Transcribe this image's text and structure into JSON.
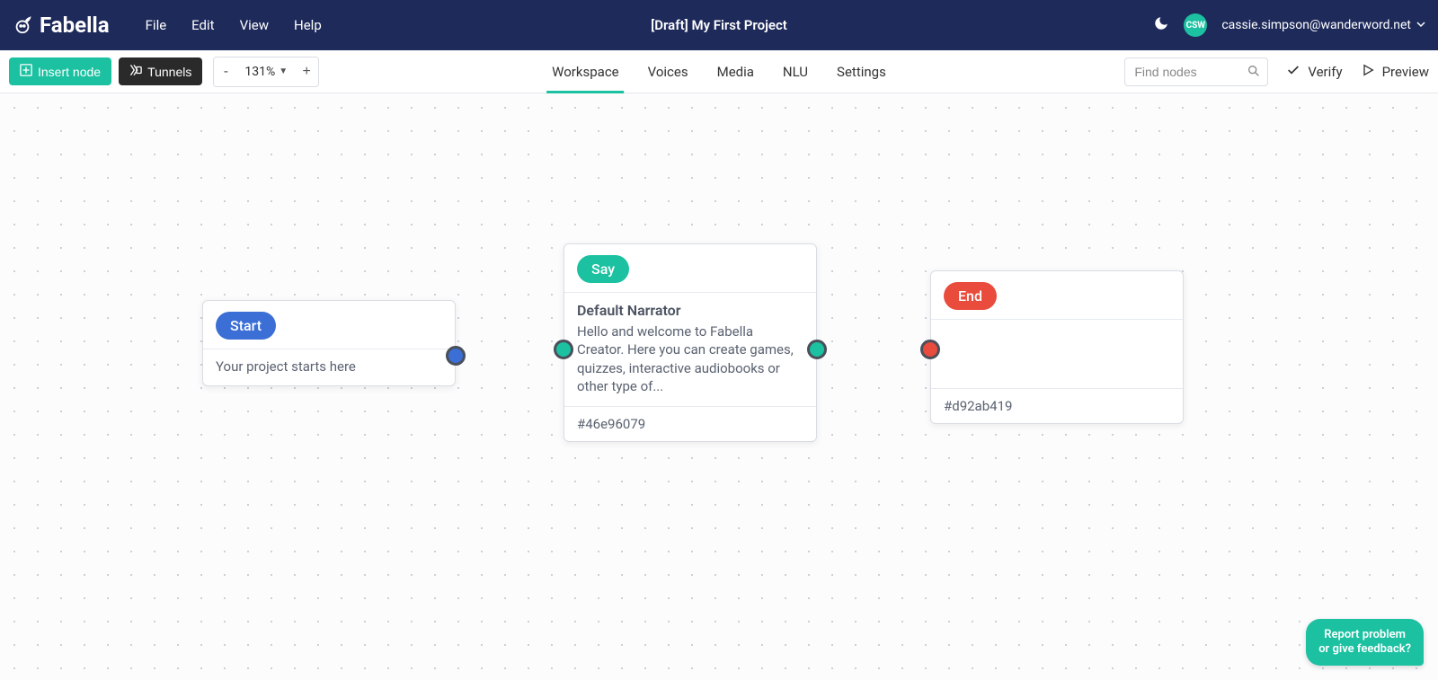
{
  "brand": {
    "name": "Fabella"
  },
  "menu": {
    "file": "File",
    "edit": "Edit",
    "view": "View",
    "help": "Help"
  },
  "project": {
    "title": "[Draft] My First Project"
  },
  "user": {
    "initials": "CSW",
    "email": "cassie.simpson@wanderword.net"
  },
  "toolbar": {
    "insert_label": "Insert node",
    "tunnels_label": "Tunnels",
    "zoom": "131%",
    "tabs": {
      "workspace": "Workspace",
      "voices": "Voices",
      "media": "Media",
      "nlu": "NLU",
      "settings": "Settings"
    },
    "search_placeholder": "Find nodes",
    "verify_label": "Verify",
    "preview_label": "Preview"
  },
  "nodes": {
    "start": {
      "label": "Start",
      "body": "Your project starts here"
    },
    "say": {
      "label": "Say",
      "subtitle": "Default Narrator",
      "text": "Hello and welcome to Fabella Creator. Here you can create games, quizzes, interactive audiobooks or other type of...",
      "id": "#46e96079"
    },
    "end": {
      "label": "End",
      "id": "#d92ab419"
    }
  },
  "feedback": {
    "line1": "Report problem",
    "line2": "or give feedback?"
  }
}
